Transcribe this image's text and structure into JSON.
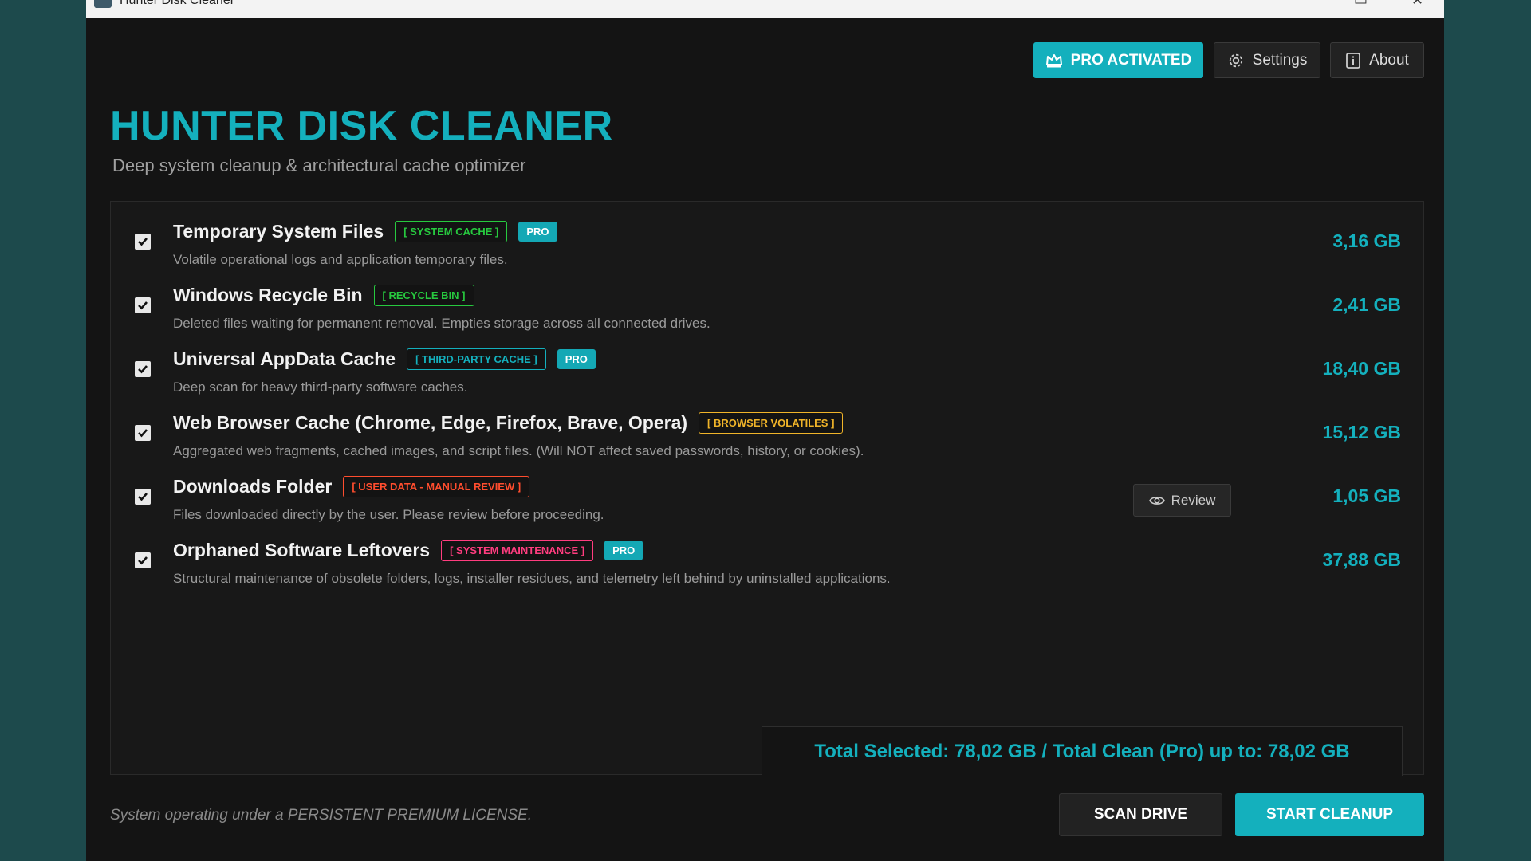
{
  "window": {
    "title": "Hunter Disk Cleaner",
    "minimize": "▭",
    "close": "✕"
  },
  "header": {
    "pro_label": "PRO ACTIVATED",
    "settings_label": "Settings",
    "about_label": "About",
    "app_title": "HUNTER DISK CLEANER",
    "app_subtitle": "Deep system cleanup & architectural cache optimizer"
  },
  "items": [
    {
      "name": "Temporary System Files",
      "tag": "[ SYSTEM CACHE ]",
      "tag_color": "#27c93f",
      "pro": "PRO",
      "desc": "Volatile operational logs and application temporary files.",
      "size": "3,16 GB",
      "checked": true
    },
    {
      "name": "Windows Recycle Bin",
      "tag": "[ RECYCLE BIN ]",
      "tag_color": "#27c93f",
      "pro": "",
      "desc": "Deleted files waiting for permanent removal. Empties storage across all connected drives.",
      "size": "2,41 GB",
      "checked": true
    },
    {
      "name": "Universal AppData Cache",
      "tag": "[ THIRD-PARTY CACHE ]",
      "tag_color": "#14b0bd",
      "pro": "PRO",
      "desc": "Deep scan for heavy third-party software caches.",
      "size": "18,40 GB",
      "checked": true
    },
    {
      "name": "Web Browser Cache (Chrome, Edge, Firefox, Brave, Opera)",
      "tag": "[ BROWSER VOLATILES ]",
      "tag_color": "#f0b429",
      "pro": "",
      "desc": "Aggregated web fragments, cached images, and script files. (Will NOT affect saved passwords, history, or cookies).",
      "size": "15,12 GB",
      "checked": true
    },
    {
      "name": "Downloads Folder",
      "tag": "[ USER DATA - MANUAL REVIEW ]",
      "tag_color": "#ff4d2e",
      "pro": "",
      "desc": "Files downloaded directly by the user. Please review before proceeding.",
      "size": "1,05 GB",
      "checked": true,
      "review_label": "Review"
    },
    {
      "name": "Orphaned Software Leftovers",
      "tag": "[ SYSTEM MAINTENANCE ]",
      "tag_color": "#ff3d7f",
      "pro": "PRO",
      "desc": "Structural maintenance of obsolete folders, logs, installer residues, and telemetry left behind by uninstalled applications.",
      "size": "37,88 GB",
      "checked": true
    }
  ],
  "total_text": "Total Selected: 78,02 GB / Total Clean (Pro) up to: 78,02 GB",
  "footer": {
    "license_text": "System operating under a PERSISTENT PREMIUM LICENSE.",
    "scan_label": "SCAN DRIVE",
    "start_label": "START CLEANUP"
  }
}
